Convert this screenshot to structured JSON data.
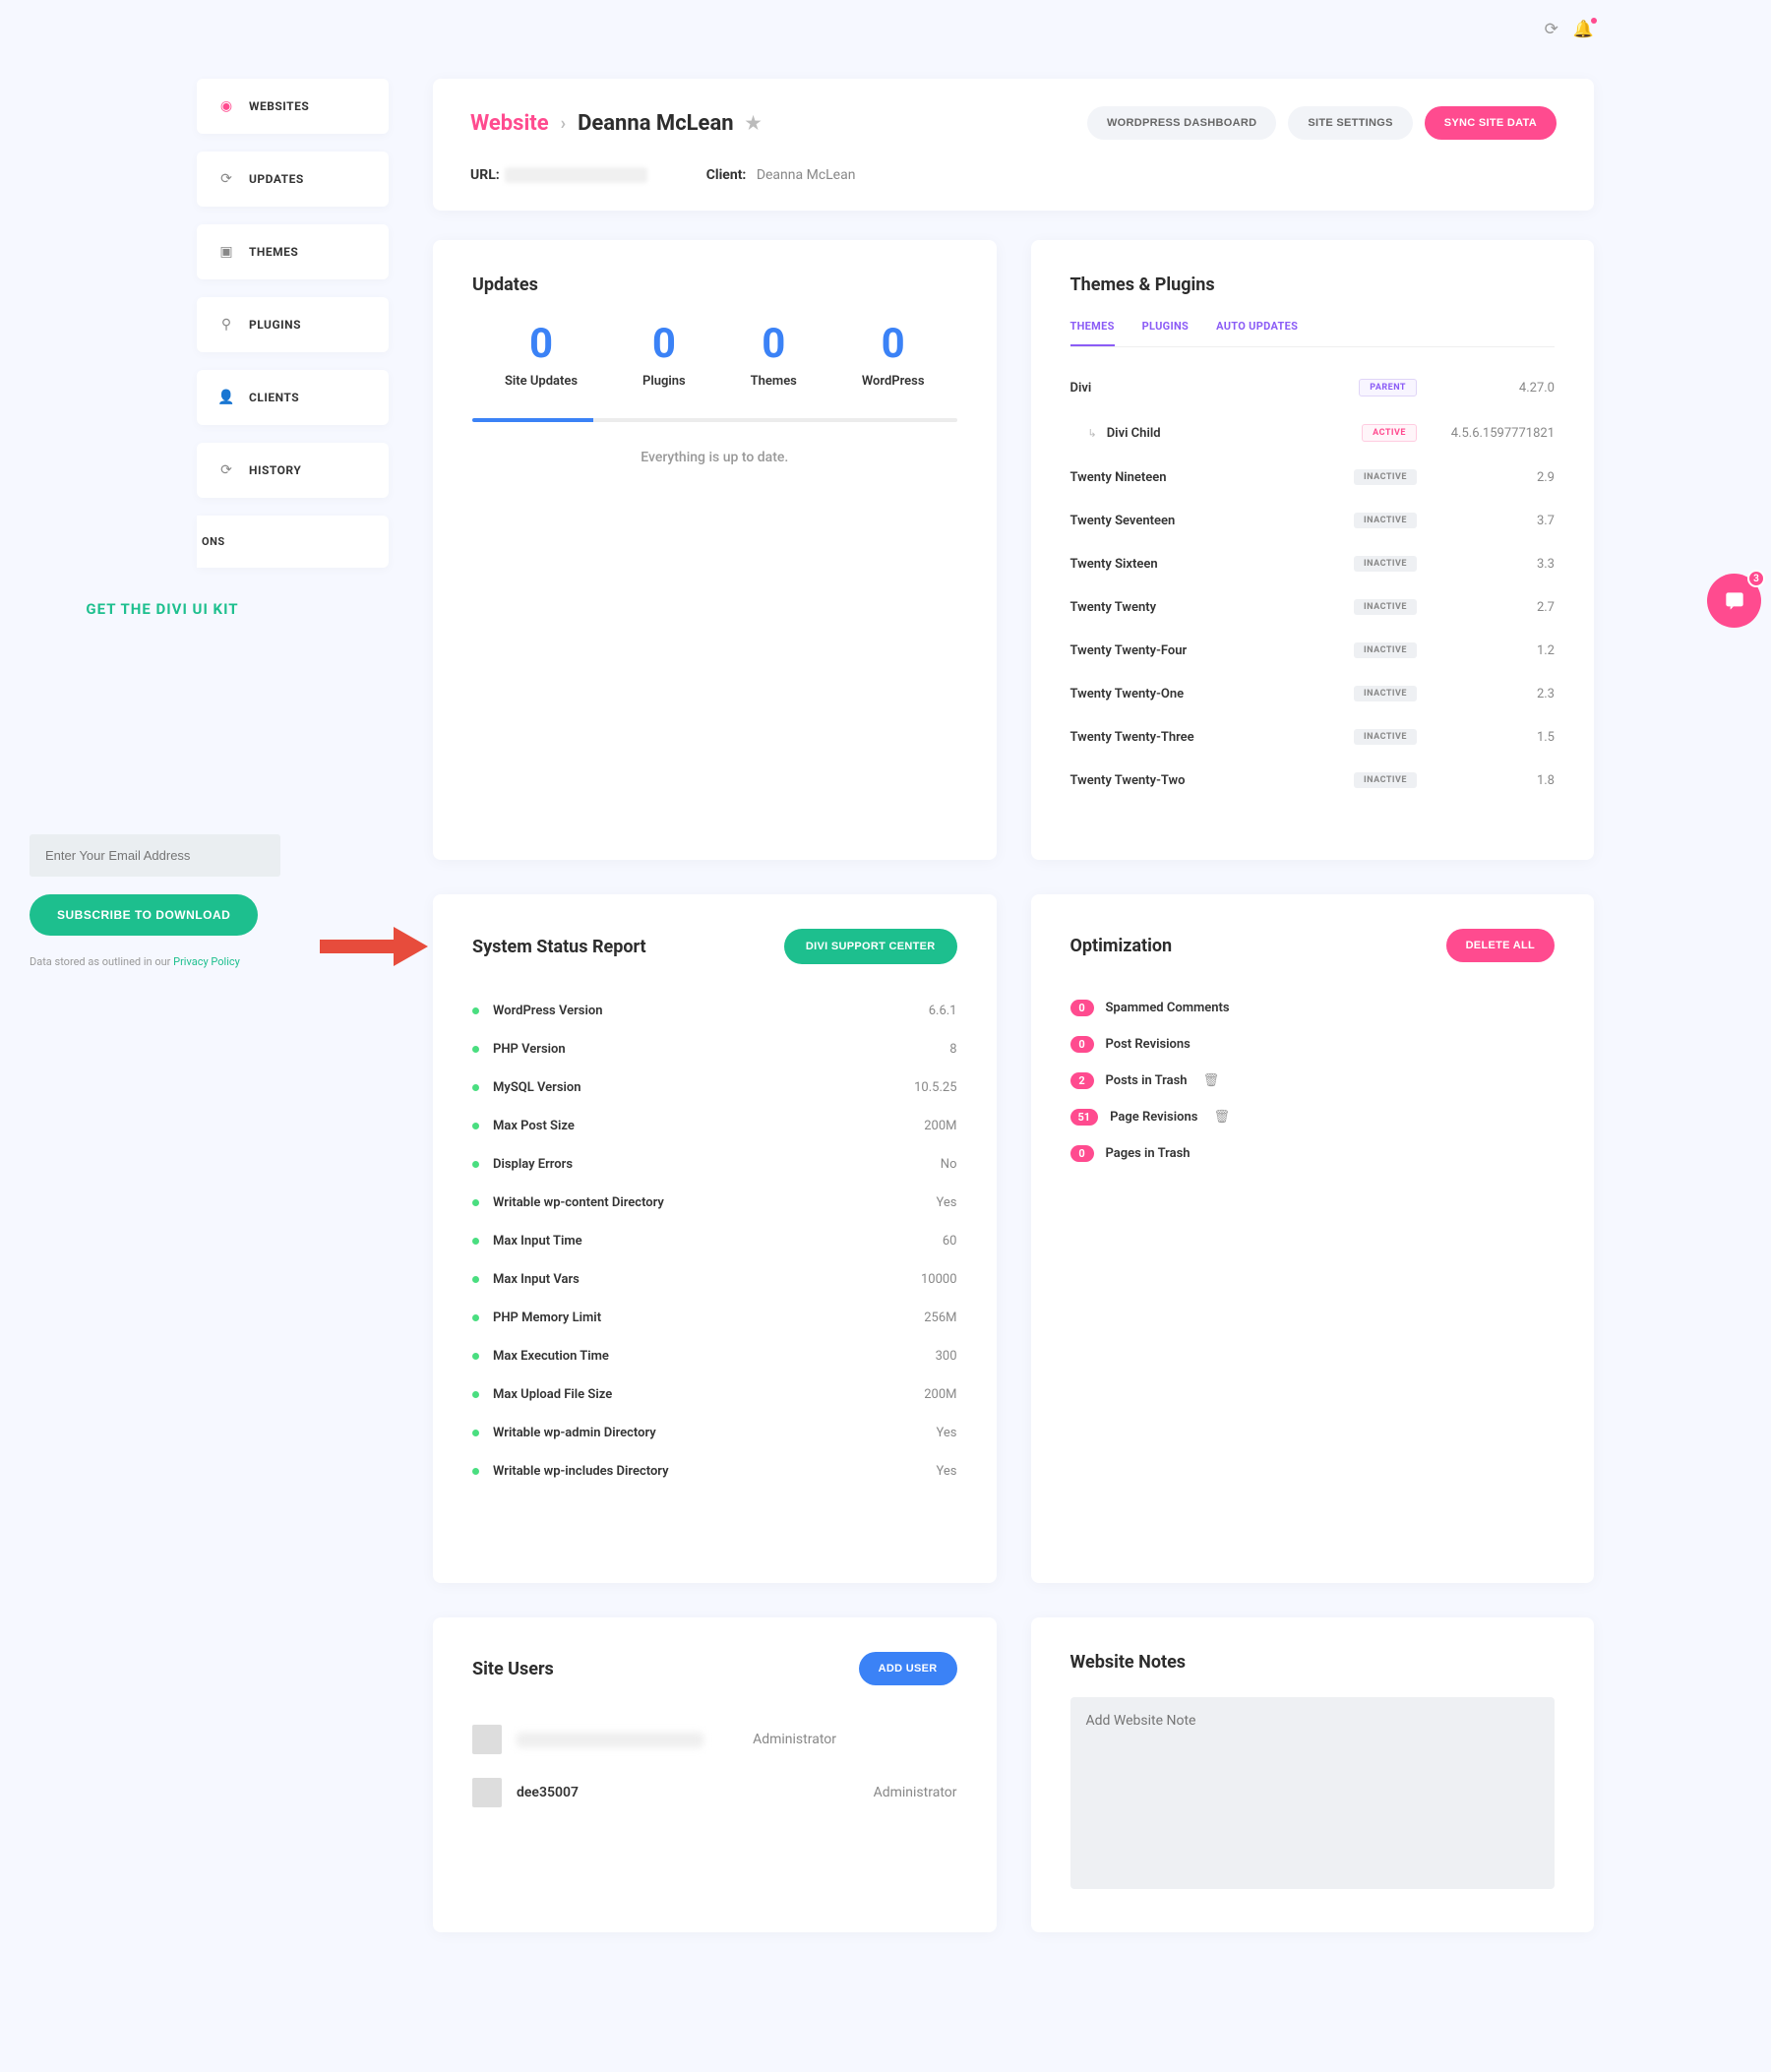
{
  "nav": {
    "items": [
      {
        "label": "WEBSITES",
        "icon": "globe",
        "active": true
      },
      {
        "label": "UPDATES",
        "icon": "refresh"
      },
      {
        "label": "THEMES",
        "icon": "layout"
      },
      {
        "label": "PLUGINS",
        "icon": "plug"
      },
      {
        "label": "CLIENTS",
        "icon": "user"
      },
      {
        "label": "HISTORY",
        "icon": "refresh"
      }
    ],
    "partial": "ONS"
  },
  "left_panel": {
    "title": "GET THE DIVI UI KIT",
    "email_placeholder": "Enter Your Email Address",
    "subscribe_label": "SUBSCRIBE TO DOWNLOAD",
    "policy_prefix": "Data stored as outlined in our ",
    "policy_link": "Privacy Policy"
  },
  "header": {
    "crumb_root": "Website",
    "crumb_name": "Deanna McLean",
    "actions": {
      "wp_dashboard": "WORDPRESS DASHBOARD",
      "site_settings": "SITE SETTINGS",
      "sync": "SYNC SITE DATA"
    },
    "meta": {
      "url_label": "URL:",
      "client_label": "Client:",
      "client_value": "Deanna McLean"
    }
  },
  "updates": {
    "title": "Updates",
    "stats": [
      {
        "number": "0",
        "label": "Site Updates"
      },
      {
        "number": "0",
        "label": "Plugins"
      },
      {
        "number": "0",
        "label": "Themes"
      },
      {
        "number": "0",
        "label": "WordPress"
      }
    ],
    "status": "Everything is up to date."
  },
  "themes_plugins": {
    "title": "Themes & Plugins",
    "tabs": [
      "THEMES",
      "PLUGINS",
      "AUTO UPDATES"
    ],
    "items": [
      {
        "name": "Divi",
        "badge": "PARENT",
        "badge_class": "parent",
        "version": "4.27.0",
        "child": false
      },
      {
        "name": "Divi Child",
        "badge": "ACTIVE",
        "badge_class": "active-b",
        "version": "4.5.6.1597771821",
        "child": true
      },
      {
        "name": "Twenty Nineteen",
        "badge": "INACTIVE",
        "badge_class": "inactive",
        "version": "2.9",
        "child": false
      },
      {
        "name": "Twenty Seventeen",
        "badge": "INACTIVE",
        "badge_class": "inactive",
        "version": "3.7",
        "child": false
      },
      {
        "name": "Twenty Sixteen",
        "badge": "INACTIVE",
        "badge_class": "inactive",
        "version": "3.3",
        "child": false
      },
      {
        "name": "Twenty Twenty",
        "badge": "INACTIVE",
        "badge_class": "inactive",
        "version": "2.7",
        "child": false
      },
      {
        "name": "Twenty Twenty-Four",
        "badge": "INACTIVE",
        "badge_class": "inactive",
        "version": "1.2",
        "child": false
      },
      {
        "name": "Twenty Twenty-One",
        "badge": "INACTIVE",
        "badge_class": "inactive",
        "version": "2.3",
        "child": false
      },
      {
        "name": "Twenty Twenty-Three",
        "badge": "INACTIVE",
        "badge_class": "inactive",
        "version": "1.5",
        "child": false
      },
      {
        "name": "Twenty Twenty-Two",
        "badge": "INACTIVE",
        "badge_class": "inactive",
        "version": "1.8",
        "child": false
      }
    ]
  },
  "system_status": {
    "title": "System Status Report",
    "button": "DIVI SUPPORT CENTER",
    "rows": [
      {
        "name": "WordPress Version",
        "value": "6.6.1"
      },
      {
        "name": "PHP Version",
        "value": "8"
      },
      {
        "name": "MySQL Version",
        "value": "10.5.25"
      },
      {
        "name": "Max Post Size",
        "value": "200M"
      },
      {
        "name": "Display Errors",
        "value": "No"
      },
      {
        "name": "Writable wp-content Directory",
        "value": "Yes"
      },
      {
        "name": "Max Input Time",
        "value": "60"
      },
      {
        "name": "Max Input Vars",
        "value": "10000"
      },
      {
        "name": "PHP Memory Limit",
        "value": "256M"
      },
      {
        "name": "Max Execution Time",
        "value": "300"
      },
      {
        "name": "Max Upload File Size",
        "value": "200M"
      },
      {
        "name": "Writable wp-admin Directory",
        "value": "Yes"
      },
      {
        "name": "Writable wp-includes Directory",
        "value": "Yes"
      }
    ]
  },
  "optimization": {
    "title": "Optimization",
    "delete_all": "DELETE ALL",
    "rows": [
      {
        "count": "0",
        "label": "Spammed Comments",
        "trash": false
      },
      {
        "count": "0",
        "label": "Post Revisions",
        "trash": false
      },
      {
        "count": "2",
        "label": "Posts in Trash",
        "trash": true
      },
      {
        "count": "51",
        "label": "Page Revisions",
        "trash": true
      },
      {
        "count": "0",
        "label": "Pages in Trash",
        "trash": false
      }
    ]
  },
  "site_users": {
    "title": "Site Users",
    "add_user": "ADD USER",
    "users": [
      {
        "name": "",
        "role": "Administrator",
        "blurred": true
      },
      {
        "name": "dee35007",
        "role": "Administrator",
        "blurred": false
      }
    ]
  },
  "notes": {
    "title": "Website Notes",
    "placeholder": "Add Website Note"
  },
  "intercom": {
    "badge": "3"
  }
}
